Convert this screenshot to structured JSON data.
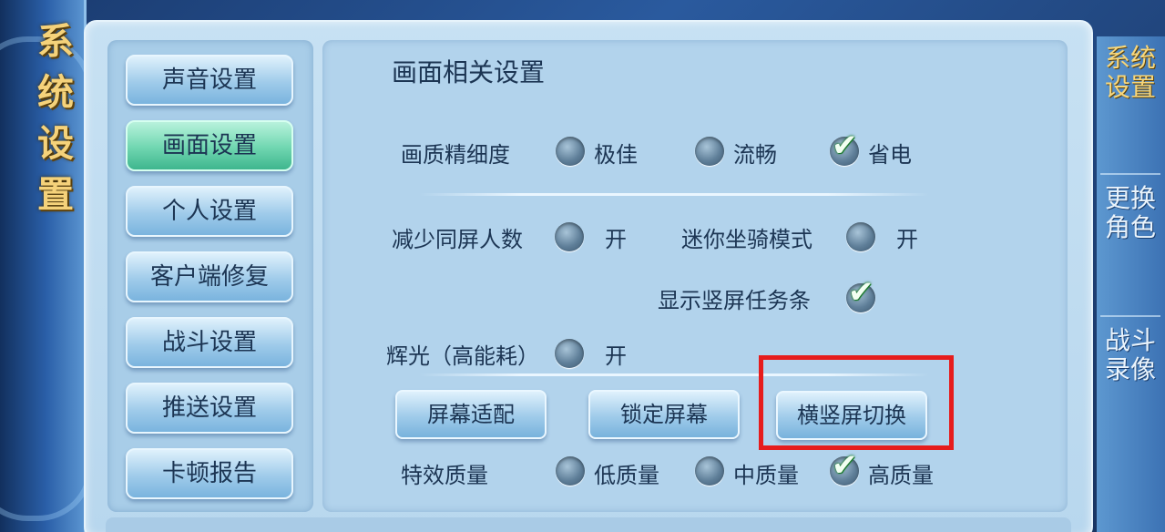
{
  "window": {
    "side_title": "系统设置"
  },
  "categories": [
    {
      "label": "声音设置"
    },
    {
      "label": "画面设置"
    },
    {
      "label": "个人设置"
    },
    {
      "label": "客户端修复"
    },
    {
      "label": "战斗设置"
    },
    {
      "label": "推送设置"
    },
    {
      "label": "卡顿报告"
    }
  ],
  "section_title": "画面相关设置",
  "quality": {
    "label": "画质精细度",
    "options": [
      {
        "label": "极佳",
        "checked": false
      },
      {
        "label": "流畅",
        "checked": false
      },
      {
        "label": "省电",
        "checked": true
      }
    ]
  },
  "reduce_players": {
    "label": "减少同屏人数",
    "state": "开"
  },
  "mini_mount": {
    "label": "迷你坐骑模式",
    "state": "开"
  },
  "portrait_taskbar": {
    "label": "显示竖屏任务条",
    "checked": true
  },
  "glow": {
    "label": "辉光（高能耗）",
    "state": "开"
  },
  "buttons": {
    "screen_fit": "屏幕适配",
    "lock_screen": "锁定屏幕",
    "orientation_switch": "横竖屏切换"
  },
  "effects": {
    "label": "特效质量",
    "options": [
      {
        "label": "低质量",
        "checked": false
      },
      {
        "label": "中质量",
        "checked": false
      },
      {
        "label": "高质量",
        "checked": true
      }
    ]
  },
  "right_tabs": [
    {
      "label": "系统设置",
      "active": true
    },
    {
      "label": "更换角色",
      "active": false
    },
    {
      "label": "战斗录像",
      "active": false
    }
  ],
  "check_glyph": "✔"
}
